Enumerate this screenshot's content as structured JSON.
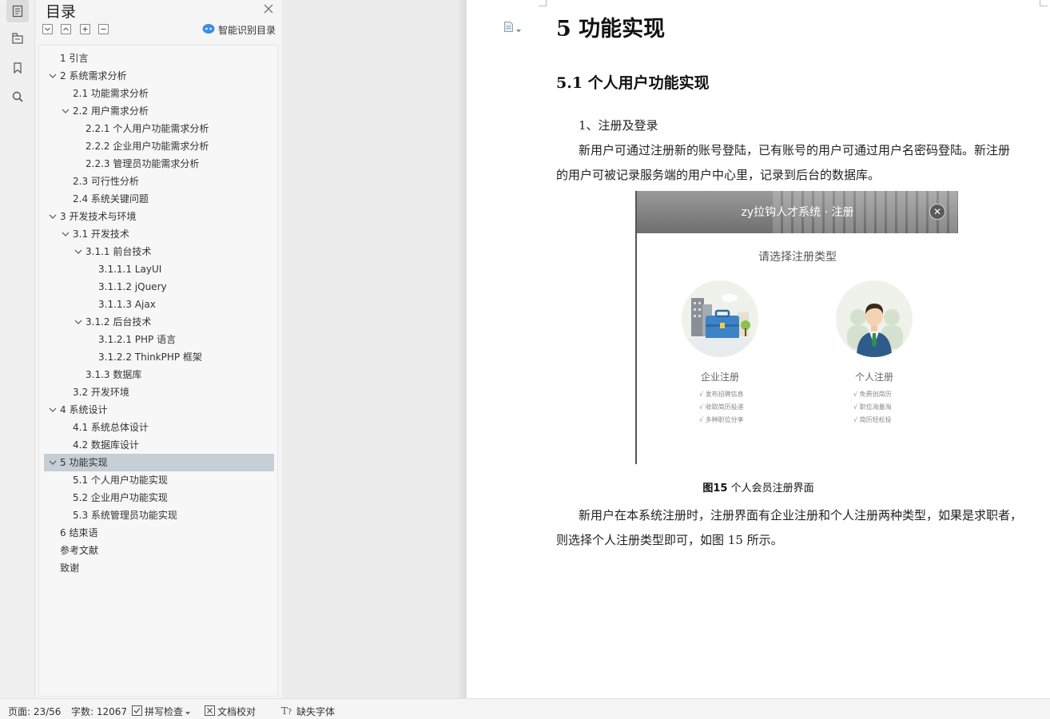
{
  "toc_panel": {
    "title": "目录",
    "smart_toc_label": "智能识别目录",
    "items": [
      {
        "label": "1 引言",
        "level": 1,
        "expandable": false
      },
      {
        "label": "2 系统需求分析",
        "level": 1,
        "expandable": true
      },
      {
        "label": "2.1 功能需求分析",
        "level": 2,
        "expandable": false
      },
      {
        "label": "2.2 用户需求分析",
        "level": 2,
        "expandable": true
      },
      {
        "label": "2.2.1 个人用户功能需求分析",
        "level": 3,
        "expandable": false
      },
      {
        "label": "2.2.2 企业用户功能需求分析",
        "level": 3,
        "expandable": false
      },
      {
        "label": "2.2.3 管理员功能需求分析",
        "level": 3,
        "expandable": false
      },
      {
        "label": "2.3 可行性分析",
        "level": 2,
        "expandable": false
      },
      {
        "label": "2.4 系统关键问题",
        "level": 2,
        "expandable": false
      },
      {
        "label": "3 开发技术与环境",
        "level": 1,
        "expandable": true
      },
      {
        "label": "3.1 开发技术",
        "level": 2,
        "expandable": true
      },
      {
        "label": "3.1.1 前台技术",
        "level": 3,
        "expandable": true
      },
      {
        "label": "3.1.1.1 LayUI",
        "level": 4,
        "expandable": false
      },
      {
        "label": "3.1.1.2 jQuery",
        "level": 4,
        "expandable": false
      },
      {
        "label": "3.1.1.3 Ajax",
        "level": 4,
        "expandable": false
      },
      {
        "label": "3.1.2 后台技术",
        "level": 3,
        "expandable": true
      },
      {
        "label": "3.1.2.1 PHP 语言",
        "level": 4,
        "expandable": false
      },
      {
        "label": "3.1.2.2 ThinkPHP 框架",
        "level": 4,
        "expandable": false
      },
      {
        "label": "3.1.3 数据库",
        "level": 3,
        "expandable": false
      },
      {
        "label": "3.2 开发环境",
        "level": 2,
        "expandable": false
      },
      {
        "label": "4 系统设计",
        "level": 1,
        "expandable": true
      },
      {
        "label": "4.1 系统总体设计",
        "level": 2,
        "expandable": false
      },
      {
        "label": "4.2 数据库设计",
        "level": 2,
        "expandable": false
      },
      {
        "label": "5 功能实现",
        "level": 1,
        "expandable": true,
        "selected": true
      },
      {
        "label": "5.1 个人用户功能实现",
        "level": 2,
        "expandable": false
      },
      {
        "label": "5.2 企业用户功能实现",
        "level": 2,
        "expandable": false
      },
      {
        "label": "5.3 系统管理员功能实现",
        "level": 2,
        "expandable": false
      },
      {
        "label": "6 结束语",
        "level": 1,
        "expandable": false
      },
      {
        "label": "参考文献",
        "level": 1,
        "expandable": false
      },
      {
        "label": "致谢",
        "level": 1,
        "expandable": false
      }
    ]
  },
  "document": {
    "heading1": "5 功能实现",
    "heading2": "5.1 个人用户功能实现",
    "item1": "1、注册及登录",
    "para1_line1": "新用户可通过注册新的账号登陆，已有账号的用户可通过用户名密码登陆。新注册",
    "para1_line2": "的用户可被记录服务端的用户中心里，记录到后台的数据库。",
    "figure": {
      "title": "zy拉钩人才系统 · 注册",
      "subtitle": "请选择注册类型",
      "close_glyph": "✕",
      "enterprise": {
        "label": "企业注册",
        "features": [
          "√ 发布招聘信息",
          "√ 收取简历投递",
          "√ 多种职位分享"
        ]
      },
      "personal": {
        "label": "个人注册",
        "features": [
          "√ 免费创简历",
          "√ 职位海量淘",
          "√ 简历轻松投"
        ]
      }
    },
    "caption_num": "图15",
    "caption_text": "个人会员注册界面",
    "para2_line1": "新用户在本系统注册时，注册界面有企业注册和个人注册两种类型，如果是求职者，",
    "para2_line2": "则选择个人注册类型即可，如图 15 所示。"
  },
  "status_bar": {
    "page": "页面: 23/56",
    "words": "字数: 12067",
    "spell_check": "拼写检查",
    "doc_proof": "文档校对",
    "missing_font": "缺失字体"
  },
  "colors": {
    "selected_row": "#c6ced6",
    "smart_icon": "#3a8ee6",
    "figure_header": "#7d7d7d",
    "enterprise_blue": "#3d83c8",
    "personal_green": "#2f8f4e"
  }
}
